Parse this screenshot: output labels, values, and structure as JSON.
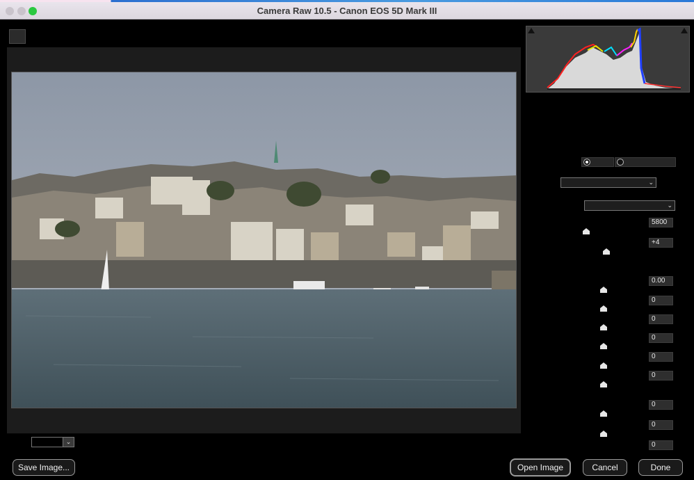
{
  "window": {
    "title": "Camera Raw 10.5  -  Canon EOS 5D Mark III"
  },
  "colors": {
    "background": "#000000",
    "panel": "#1c1c1c",
    "histogram_bg": "#3a3a3a",
    "traffic_green": "#2bc840"
  },
  "preview": {
    "image_description_icon": "photo-harbour-town"
  },
  "zoom": {
    "value": ""
  },
  "white_balance": {
    "temperature": "5800",
    "tint": "+4"
  },
  "adjustments": {
    "exposure": "0.00",
    "contrast": "0",
    "highlights": "0",
    "shadows": "0",
    "whites": "0",
    "blacks": "0",
    "clarity": "0",
    "vibrance": "0",
    "saturation": "0"
  },
  "buttons": {
    "save": "Save Image...",
    "open": "Open Image",
    "cancel": "Cancel",
    "done": "Done"
  }
}
